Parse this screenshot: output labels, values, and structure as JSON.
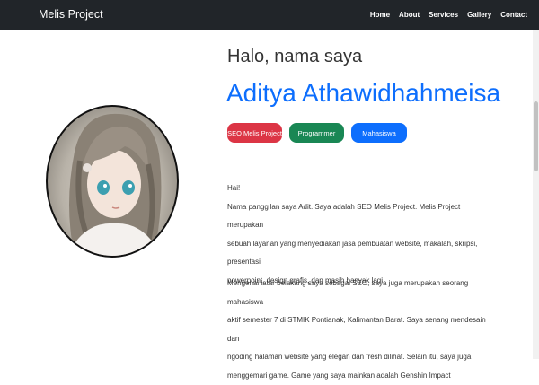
{
  "navbar": {
    "brand": "Melis Project",
    "links": [
      "Home",
      "About",
      "Services",
      "Gallery",
      "Contact"
    ]
  },
  "hero": {
    "greeting": "Halo, nama saya",
    "name": "Aditya Athawidhahmeisa",
    "badges": [
      "SEO Melis Project",
      "Programmer",
      "Mahasiswa"
    ]
  },
  "about": {
    "paragraph1": [
      "Hai!",
      "Nama panggilan saya Adit. Saya adalah SEO Melis Project. Melis Project merupakan",
      "sebuah layanan yang menyediakan jasa pembuatan website, makalah, skripsi, presentasi",
      "powerpoint, design grafis, dan masih banyak lagi."
    ],
    "paragraph2": [
      "Mengenai latar belakang saya sebagai SEO, saya juga merupakan seorang mahasiswa",
      "aktif semester 7 di STMIK Pontianak, Kalimantan Barat. Saya senang mendesain dan",
      "ngoding halaman website yang elegan dan fresh dilihat. Selain itu, saya juga",
      "menggemari game. Game yang saya mainkan adalah Genshin Impact"
    ]
  },
  "colors": {
    "navbar": "#212529",
    "accent": "#0d6efd",
    "danger": "#dc3545",
    "success": "#198754"
  }
}
